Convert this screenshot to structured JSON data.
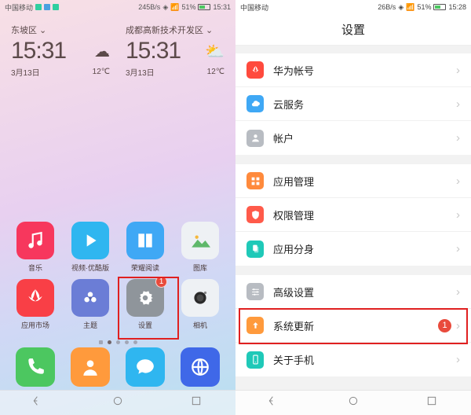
{
  "left": {
    "status": {
      "carrier": "中国移动",
      "speed": "245B/s",
      "battery": "51%",
      "time": "15:31"
    },
    "widget1": {
      "loc": "东坡区",
      "time": "15:31",
      "date": "3月13日",
      "temp": "12℃"
    },
    "widget2": {
      "loc": "成都高新技术开发区",
      "time": "15:31",
      "date": "3月13日",
      "temp": "12℃"
    },
    "apps_r1": [
      {
        "label": "音乐",
        "color": "#f7375d"
      },
      {
        "label": "视频·优酷版",
        "color": "#2fb6f0"
      },
      {
        "label": "荣耀阅读",
        "color": "#3fa8f5"
      },
      {
        "label": "图库",
        "color": "#eef1f4"
      }
    ],
    "apps_r2": [
      {
        "label": "应用市场",
        "color": "#f93f46"
      },
      {
        "label": "主题",
        "color": "#6b7dd6"
      },
      {
        "label": "设置",
        "color": "#8f959b",
        "badge": "1"
      },
      {
        "label": "相机",
        "color": "#eef1f4"
      }
    ],
    "dock": [
      {
        "name": "phone",
        "color": "#4cc760"
      },
      {
        "name": "contacts",
        "color": "#ff9a3c"
      },
      {
        "name": "messages",
        "color": "#2fb6f0"
      },
      {
        "name": "browser",
        "color": "#3f68e8"
      }
    ]
  },
  "right": {
    "status": {
      "carrier": "中国移动",
      "speed": "26B/s",
      "battery": "51%",
      "time": "15:28"
    },
    "title": "设置",
    "g1": [
      {
        "label": "华为帐号",
        "color": "#ff4a3d"
      },
      {
        "label": "云服务",
        "color": "#3fa8f5"
      },
      {
        "label": "帐户",
        "color": "#b8bcc2"
      }
    ],
    "g2": [
      {
        "label": "应用管理",
        "color": "#ff8a3c"
      },
      {
        "label": "权限管理",
        "color": "#ff5a4a"
      },
      {
        "label": "应用分身",
        "color": "#1fc9b8"
      }
    ],
    "g3": [
      {
        "label": "高级设置",
        "color": "#b8bcc2"
      },
      {
        "label": "系统更新",
        "color": "#ff9a3c",
        "badge": "1",
        "highlight": true
      },
      {
        "label": "关于手机",
        "color": "#1fc9b8"
      }
    ]
  }
}
